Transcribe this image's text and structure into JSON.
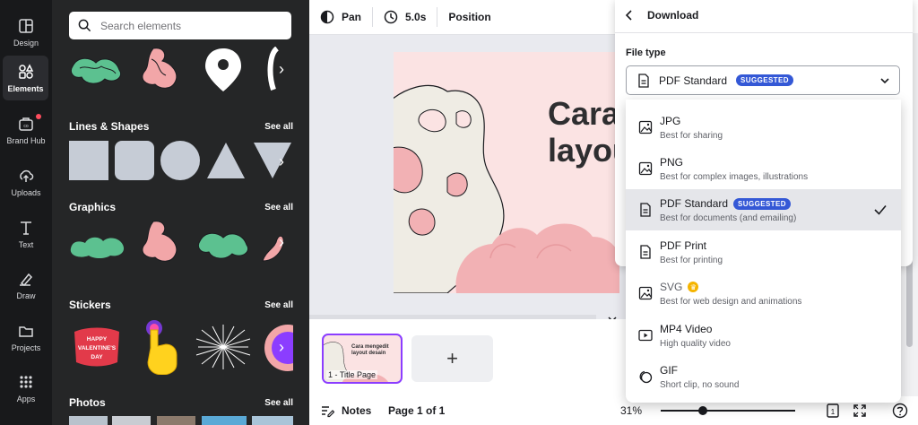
{
  "rail": {
    "items": [
      {
        "label": "Design",
        "icon": "design-icon"
      },
      {
        "label": "Elements",
        "icon": "elements-icon"
      },
      {
        "label": "Brand Hub",
        "icon": "brand-hub-icon"
      },
      {
        "label": "Uploads",
        "icon": "uploads-icon"
      },
      {
        "label": "Text",
        "icon": "text-icon"
      },
      {
        "label": "Draw",
        "icon": "draw-icon"
      },
      {
        "label": "Projects",
        "icon": "folder-icon"
      },
      {
        "label": "Apps",
        "icon": "apps-icon"
      }
    ]
  },
  "panel": {
    "search_placeholder": "Search elements",
    "sections": [
      {
        "title": "Lines & Shapes",
        "see_all": "See all"
      },
      {
        "title": "Graphics",
        "see_all": "See all"
      },
      {
        "title": "Stickers",
        "see_all": "See all"
      },
      {
        "title": "Photos",
        "see_all": "See all"
      }
    ],
    "sticker_text": "HAPPY VALENTINE'S DAY"
  },
  "toolbar": {
    "pan_label": "Pan",
    "duration_label": "5.0s",
    "position_label": "Position"
  },
  "canvas": {
    "title_line1": "Cara",
    "title_line2": "layou"
  },
  "pages": {
    "thumb_title": "Cara mengedit layout desain",
    "thumb_label": "1 - Title Page",
    "add_label": "+"
  },
  "footer": {
    "notes_label": "Notes",
    "page_indicator": "Page 1 of 1",
    "zoom": "31%",
    "zoom_fraction": 0.31,
    "page_count_badge": "1"
  },
  "download": {
    "header": "Download",
    "file_type_label": "File type",
    "selected": "PDF Standard",
    "suggested_badge": "SUGGESTED",
    "options": [
      {
        "name": "JPG",
        "desc": "Best for sharing",
        "icon": "image-icon"
      },
      {
        "name": "PNG",
        "desc": "Best for complex images, illustrations",
        "icon": "image-icon"
      },
      {
        "name": "PDF Standard",
        "desc": "Best for documents (and emailing)",
        "icon": "document-icon",
        "badge": "SUGGESTED",
        "selected": true
      },
      {
        "name": "PDF Print",
        "desc": "Best for printing",
        "icon": "document-icon"
      },
      {
        "name": "SVG",
        "desc": "Best for web design and animations",
        "icon": "image-icon",
        "premium": true
      },
      {
        "name": "MP4 Video",
        "desc": "High quality video",
        "icon": "video-icon"
      },
      {
        "name": "GIF",
        "desc": "Short clip, no sound",
        "icon": "gif-icon"
      }
    ]
  },
  "colors": {
    "rail_bg": "#18191b",
    "panel_bg": "#252627",
    "accent_badge": "#3458d6",
    "page_pink": "#fbe3e3",
    "blob_pink": "#f2b1b4",
    "graphic_green": "#5cc190"
  }
}
